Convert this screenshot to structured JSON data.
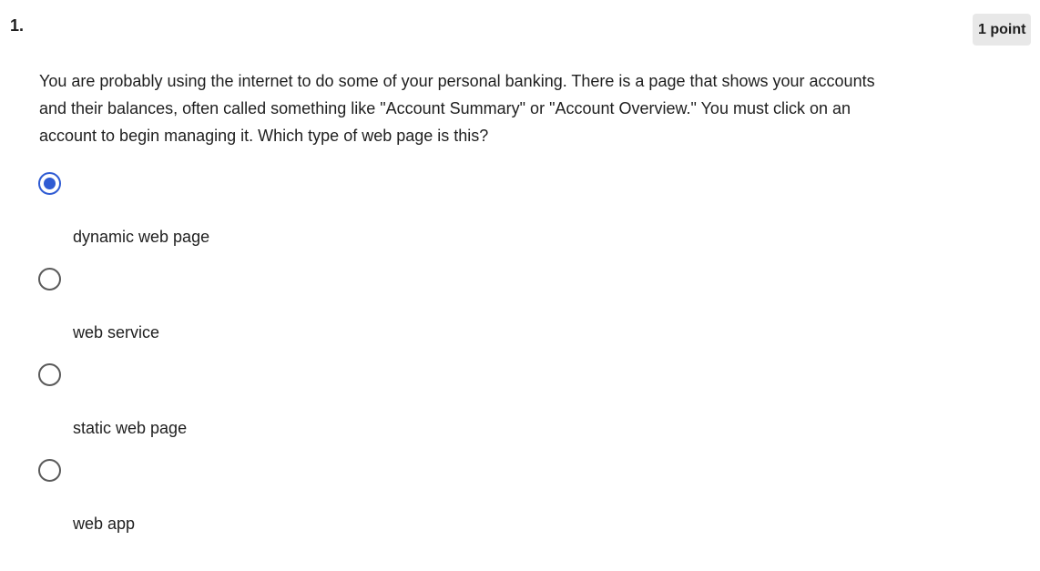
{
  "question": {
    "number": "1.",
    "points": "1 point",
    "prompt": "You are probably using the internet to do some of your personal banking. There is a page that shows your accounts and their balances, often called something like \"Account Summary\" or \"Account Overview.\" You must click on an account to begin managing it. Which type of web page is this?",
    "selected_option": "dynamic web page",
    "options": [
      {
        "label": "dynamic web page",
        "checked": true
      },
      {
        "label": "web service",
        "checked": false
      },
      {
        "label": "static web page",
        "checked": false
      },
      {
        "label": "web app",
        "checked": false
      }
    ]
  },
  "colors": {
    "accent": "#2f5bd3",
    "badge_bg": "#e8e8e8",
    "text": "#1f1f1f"
  }
}
